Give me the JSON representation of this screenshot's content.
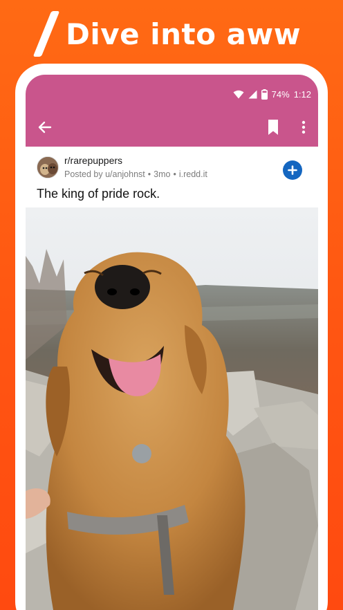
{
  "promo": {
    "headline": "Dive into aww"
  },
  "status_bar": {
    "battery": "74%",
    "time": "1:12"
  },
  "post": {
    "subreddit": "r/rarepuppers",
    "author": "Posted by u/anjohnst",
    "age": "3mo",
    "domain": "i.redd.it",
    "separator": "•",
    "title": "The king of pride rock."
  },
  "icons": {
    "back": "arrow-left-icon",
    "bookmark": "bookmark-icon",
    "more": "more-vertical-icon",
    "join": "plus-icon",
    "wifi": "wifi-icon",
    "signal": "signal-icon",
    "battery": "battery-icon"
  },
  "colors": {
    "background": "#ff5a14",
    "app_bar": "#c9558c",
    "join_button": "#1466c0"
  }
}
